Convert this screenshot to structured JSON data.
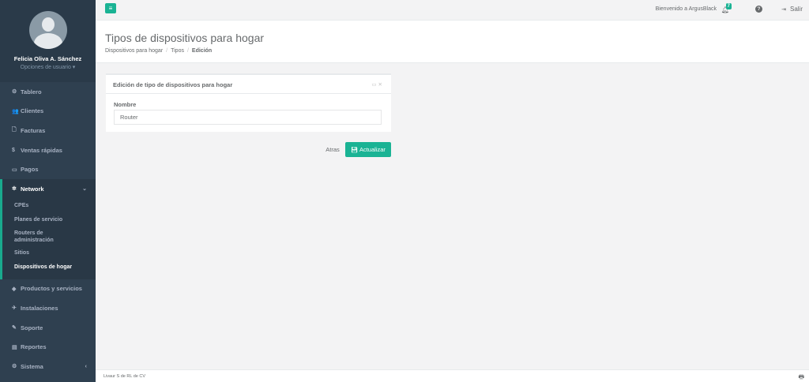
{
  "profile": {
    "name": "Felicia Oliva A. Sánchez",
    "options": "Opciones de usuario ▾"
  },
  "sidebar": {
    "items_top": [
      {
        "icon": "dashboard-icon",
        "glyph": "⚙",
        "label": "Tablero"
      },
      {
        "icon": "users-icon",
        "glyph": "👥",
        "label": "Clientes"
      },
      {
        "icon": "document-icon",
        "glyph": "🗋",
        "label": "Facturas"
      },
      {
        "icon": "dollar-icon",
        "glyph": "$",
        "label": "Ventas rápidas"
      },
      {
        "icon": "card-icon",
        "glyph": "▭",
        "label": "Pagos"
      }
    ],
    "network": {
      "icon": "network-icon",
      "glyph": "✲",
      "label": "Network",
      "chevron": "⌄",
      "sub_items": [
        "CPEs",
        "Planes de servicio",
        "Routers de administración",
        "Sitios",
        "Dispositivos de hogar"
      ]
    },
    "items_bottom": [
      {
        "icon": "tag-icon",
        "glyph": "◆",
        "label": "Productos y servicios"
      },
      {
        "icon": "rocket-icon",
        "glyph": "✈",
        "label": "Instalaciones"
      },
      {
        "icon": "wrench-icon",
        "glyph": "✎",
        "label": "Soporte"
      },
      {
        "icon": "chart-icon",
        "glyph": "▤",
        "label": "Reportes"
      },
      {
        "icon": "cogs-icon",
        "glyph": "⚙",
        "label": "Sistema",
        "chevron": "‹"
      }
    ]
  },
  "topbar": {
    "menu_glyph": "≡",
    "welcome": "Bienvenido a ArgusBlack",
    "notifications": "7",
    "logout": "Salir"
  },
  "heading": {
    "title": "Tipos de dispositivos para hogar",
    "breadcrumb": [
      "Dispositivos para hogar",
      "Tipos",
      "Edición"
    ]
  },
  "card": {
    "title": "Edición de tipo de dispositivos para hogar",
    "field_label": "Nombre",
    "field_value": "Router"
  },
  "actions": {
    "back": "Atras",
    "update": "Actualizar"
  },
  "footer": {
    "text": "Livaur S de RL de CV"
  },
  "colors": {
    "accent": "#1ab394",
    "sidebar": "#2f4050"
  }
}
